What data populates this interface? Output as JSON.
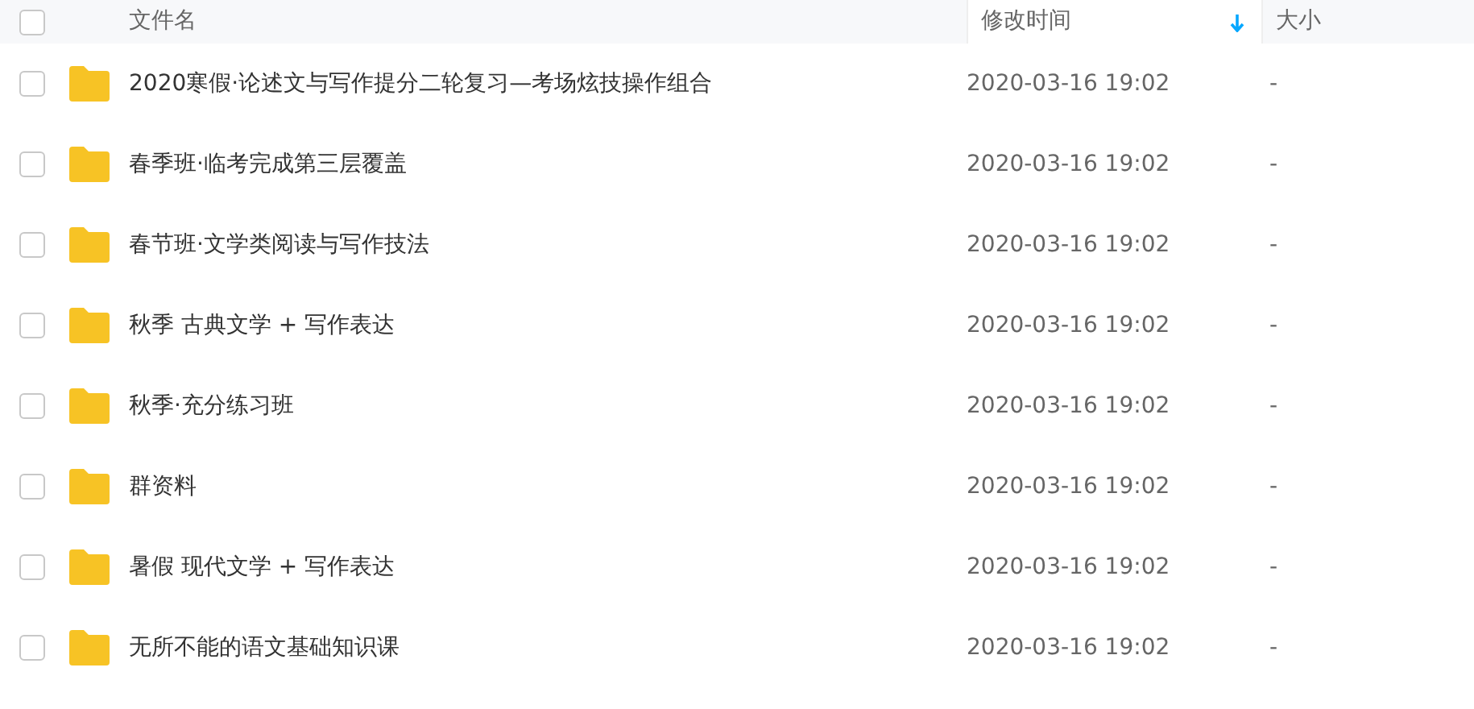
{
  "table": {
    "select_all": {
      "checked": false
    },
    "columns": [
      {
        "label": "文件名",
        "sorted": false
      },
      {
        "label": "修改时间",
        "sorted": true
      },
      {
        "label": "大小",
        "sorted": false
      }
    ],
    "rows": [
      {
        "name": "2020寒假·论述文与写作提分二轮复习—考场炫技操作组合",
        "modified": "2020-03-16 19:02",
        "size": "-",
        "checked": false
      },
      {
        "name": "春季班·临考完成第三层覆盖",
        "modified": "2020-03-16 19:02",
        "size": "-",
        "checked": false
      },
      {
        "name": "春节班·文学类阅读与写作技法",
        "modified": "2020-03-16 19:02",
        "size": "-",
        "checked": false
      },
      {
        "name": "秋季 古典文学 + 写作表达",
        "modified": "2020-03-16 19:02",
        "size": "-",
        "checked": false
      },
      {
        "name": "秋季·充分练习班",
        "modified": "2020-03-16 19:02",
        "size": "-",
        "checked": false
      },
      {
        "name": "群资料",
        "modified": "2020-03-16 19:02",
        "size": "-",
        "checked": false
      },
      {
        "name": "暑假 现代文学 + 写作表达",
        "modified": "2020-03-16 19:02",
        "size": "-",
        "checked": false
      },
      {
        "name": "无所不能的语文基础知识课",
        "modified": "2020-03-16 19:02",
        "size": "-",
        "checked": false
      }
    ]
  }
}
